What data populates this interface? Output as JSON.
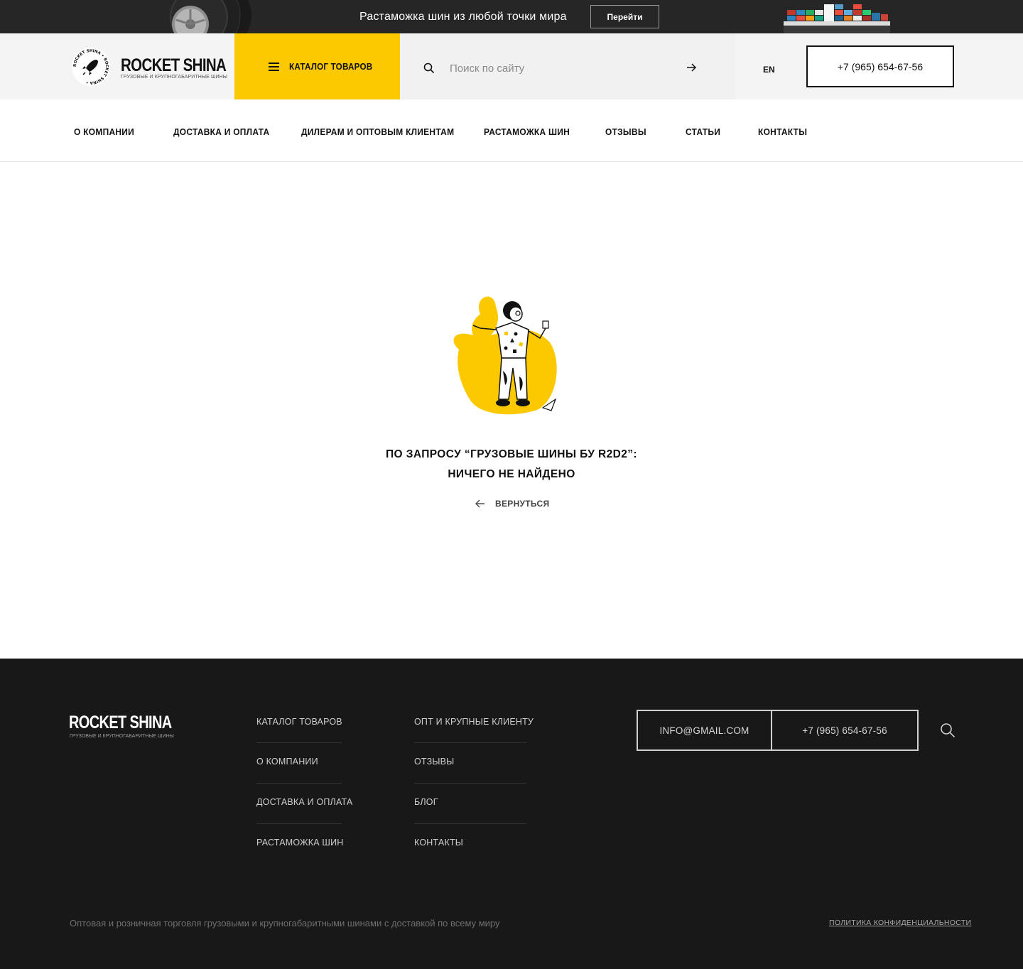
{
  "promo": {
    "text": "Растаможка шин из любой точки мира",
    "button_label": "Перейти"
  },
  "header": {
    "logo_title": "ROCKET SHINA",
    "logo_subtitle": "ГРУЗОВЫЕ И КРУПНОГАБАРИТНЫЕ ШИНЫ",
    "catalog_label": "КАТАЛОГ ТОВАРОВ",
    "search_placeholder": "Поиск по сайту",
    "lang": "EN",
    "phone": "+7 (965) 654-67-56"
  },
  "nav": {
    "items": [
      {
        "label": "О КОМПАНИИ"
      },
      {
        "label": "ДОСТАВКА И ОПЛАТА"
      },
      {
        "label": "ДИЛЕРАМ И ОПТОВЫМ КЛИЕНТАМ"
      },
      {
        "label": "РАСТАМОЖКА ШИН"
      },
      {
        "label": "ОТЗЫВЫ"
      },
      {
        "label": "СТАТЬИ"
      },
      {
        "label": "КОНТАКТЫ"
      }
    ]
  },
  "main": {
    "message_line1": "ПО ЗАПРОСУ “ГРУЗОВЫЕ ШИНЫ БУ R2D2”:",
    "message_line2": "НИЧЕГО НЕ НАЙДЕНО",
    "back_label": "ВЕРНУТЬСЯ"
  },
  "footer": {
    "logo_title": "ROCKET SHINA",
    "logo_subtitle": "ГРУЗОВЫЕ И КРУПНОГАБАРИТНЫЕ ШИНЫ",
    "col1": [
      {
        "label": "КАТАЛОГ ТОВАРОВ"
      },
      {
        "label": "О КОМПАНИИ"
      },
      {
        "label": "ДОСТАВКА И ОПЛАТА"
      },
      {
        "label": "РАСТАМОЖКА ШИН"
      }
    ],
    "col2": [
      {
        "label": "ОПТ И КРУПНЫЕ КЛИЕНТУ"
      },
      {
        "label": "ОТЗЫВЫ"
      },
      {
        "label": "БЛОГ"
      },
      {
        "label": "КОНТАКТЫ"
      }
    ],
    "email": "INFO@GMAIL.COM",
    "phone": "+7 (965) 654-67-56",
    "description": "Оптовая и розничная торговля грузовыми и крупногабаритными шинами с доставкой по всему миру",
    "policy": "ПОЛИТИКА КОНФИДЕНЦИАЛЬНОСТИ"
  },
  "colors": {
    "accent": "#fcc800",
    "dark": "#181818",
    "banner": "#262626"
  },
  "logo_badge_text": "ROCKET SHINA • ROCKET SHINA •"
}
